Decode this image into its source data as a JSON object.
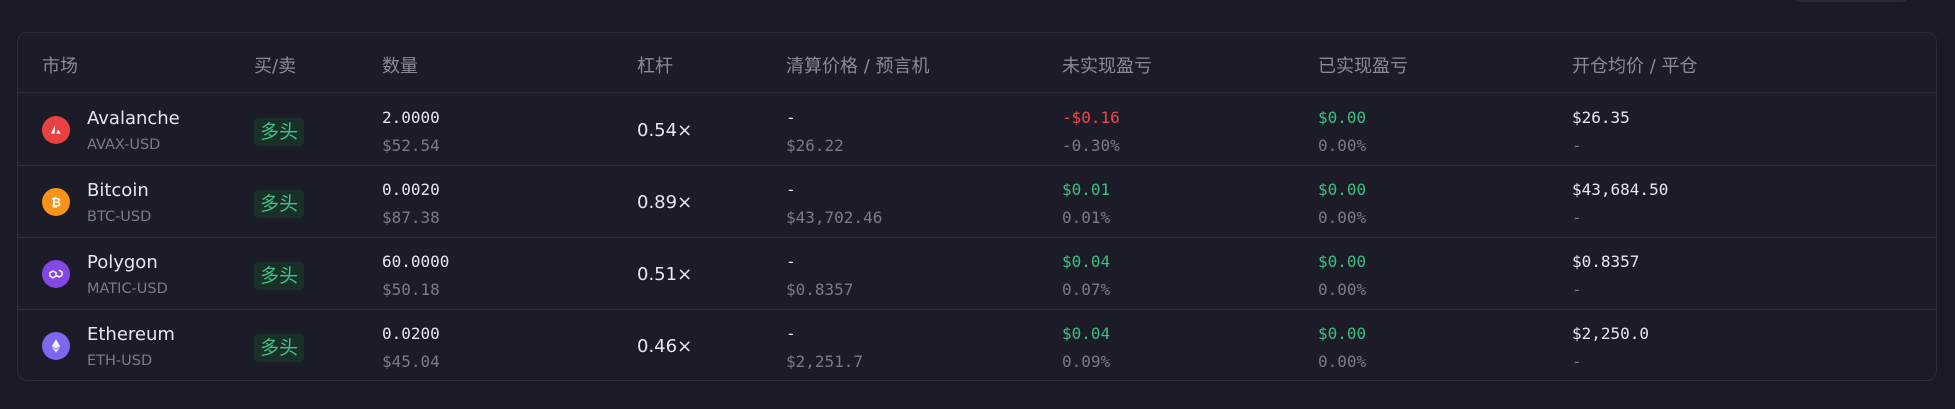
{
  "columns": {
    "market": "市场",
    "side": "买/卖",
    "size": "数量",
    "leverage": "杠杆",
    "liq_oracle": "清算价格 / 预言机",
    "unrealized": "未实现盈亏",
    "realized": "已实现盈亏",
    "entry_close": "开仓均价 / 平仓"
  },
  "rows": [
    {
      "name": "Avalanche",
      "pair": "AVAX-USD",
      "side": "多头",
      "size": "2.0000",
      "notional": "$52.54",
      "leverage": "0.54×",
      "liq": "-",
      "oracle": "$26.22",
      "upnl": "-$0.16",
      "upnl_pct": "-0.30%",
      "upnl_status": "negative",
      "rpnl": "$0.00",
      "rpnl_pct": "0.00%",
      "entry": "$26.35",
      "close": "-",
      "icon": "avalanche-icon",
      "icon_color": "#e84142"
    },
    {
      "name": "Bitcoin",
      "pair": "BTC-USD",
      "side": "多头",
      "size": "0.0020",
      "notional": "$87.38",
      "leverage": "0.89×",
      "liq": "-",
      "oracle": "$43,702.46",
      "upnl": "$0.01",
      "upnl_pct": "0.01%",
      "upnl_status": "positive",
      "rpnl": "$0.00",
      "rpnl_pct": "0.00%",
      "entry": "$43,684.50",
      "close": "-",
      "icon": "bitcoin-icon",
      "icon_color": "#f7931a"
    },
    {
      "name": "Polygon",
      "pair": "MATIC-USD",
      "side": "多头",
      "size": "60.0000",
      "notional": "$50.18",
      "leverage": "0.51×",
      "liq": "-",
      "oracle": "$0.8357",
      "upnl": "$0.04",
      "upnl_pct": "0.07%",
      "upnl_status": "positive",
      "rpnl": "$0.00",
      "rpnl_pct": "0.00%",
      "entry": "$0.8357",
      "close": "-",
      "icon": "polygon-icon",
      "icon_color": "#8247e5"
    },
    {
      "name": "Ethereum",
      "pair": "ETH-USD",
      "side": "多头",
      "size": "0.0200",
      "notional": "$45.04",
      "leverage": "0.46×",
      "liq": "-",
      "oracle": "$2,251.7",
      "upnl": "$0.04",
      "upnl_pct": "0.09%",
      "upnl_status": "positive",
      "rpnl": "$0.00",
      "rpnl_pct": "0.00%",
      "entry": "$2,250.0",
      "close": "-",
      "icon": "ethereum-icon",
      "icon_color": "#7b68ee"
    }
  ],
  "colors": {
    "positive": "#3fbf83",
    "negative": "#f0454a",
    "long_badge_bg": "#183028"
  }
}
